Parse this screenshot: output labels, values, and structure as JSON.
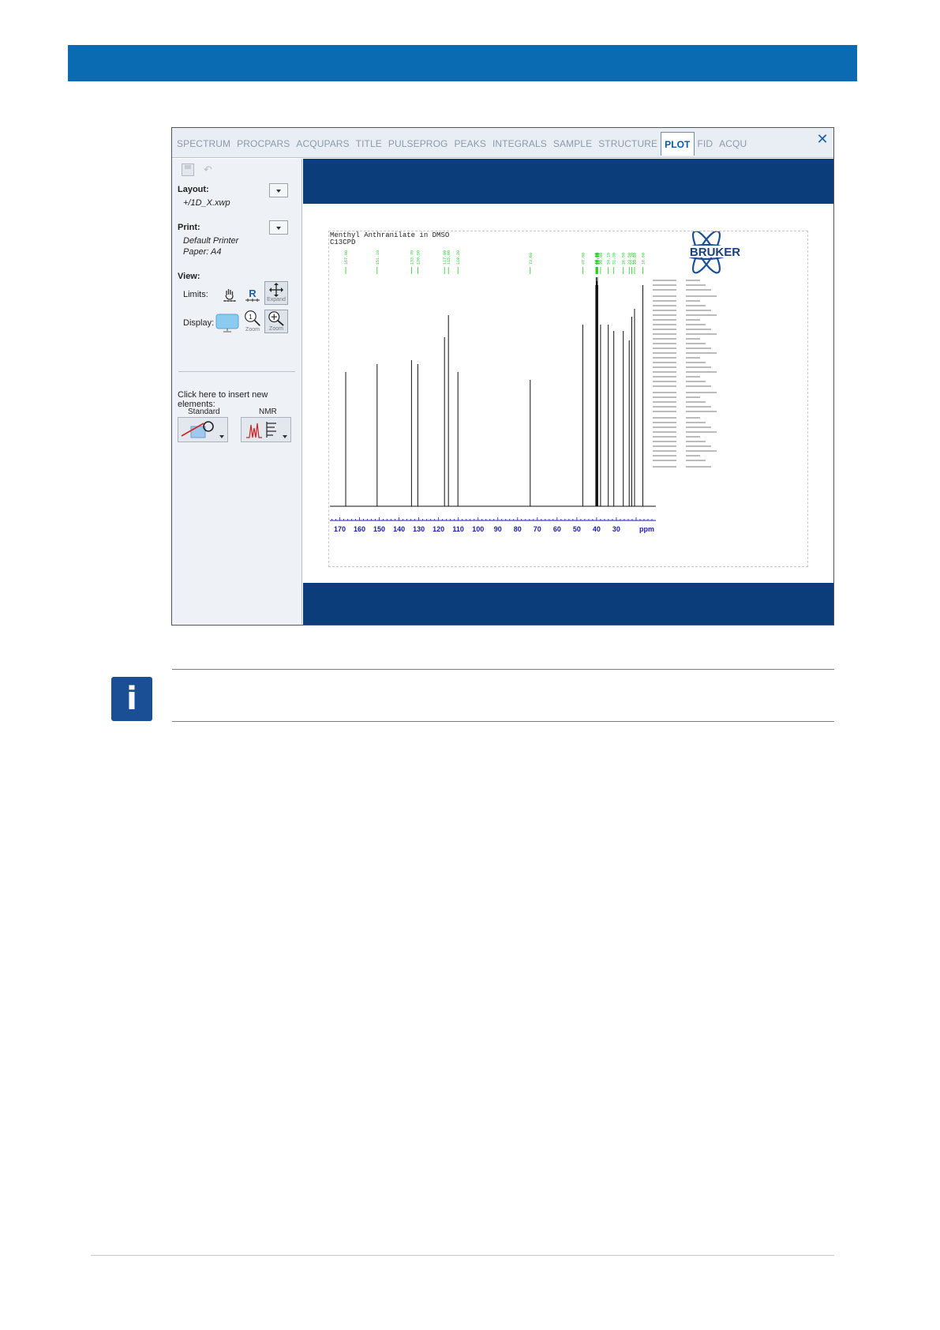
{
  "tabs": [
    "SPECTRUM",
    "PROCPARS",
    "ACQUPARS",
    "TITLE",
    "PULSEPROG",
    "PEAKS",
    "INTEGRALS",
    "SAMPLE",
    "STRUCTURE",
    "PLOT",
    "FID",
    "ACQU"
  ],
  "active_tab": "PLOT",
  "close_symbol": "✕",
  "panel": {
    "layout_label": "Layout:",
    "layout_value": "+/1D_X.xwp",
    "print_label": "Print:",
    "printer_value": "Default Printer",
    "paper_value": "Paper: A4",
    "view_label": "View:",
    "limits_label": "Limits:",
    "limits_r": "R",
    "expand_label": "Expand",
    "display_label": "Display:",
    "zoom_label_1": "Zoom",
    "zoom_label_2": "Zoom",
    "zoom_one": "1",
    "insert_label": "Click here to insert new elements:",
    "standard_label": "Standard",
    "nmr_label": "NMR"
  },
  "plot": {
    "title": "Menthyl Anthranilate in DMSO",
    "subtitle": "C13CPD",
    "logo_text": "BRUKER",
    "x_axis_unit": "ppm",
    "x_ticks": [
      "170",
      "160",
      "150",
      "140",
      "130",
      "120",
      "110",
      "100",
      "90",
      "80",
      "70",
      "60",
      "50",
      "40",
      "30"
    ],
    "peaks_ppm": [
      167.0,
      151.1,
      133.7,
      130.5,
      117.0,
      115.0,
      110.2,
      73.6,
      47.0,
      40.4,
      40.2,
      40.0,
      39.8,
      39.6,
      39.4,
      38.0,
      34.1,
      31.3,
      26.5,
      23.5,
      22.2,
      20.8,
      16.6
    ],
    "colors": {
      "axis": "#1a1ab0",
      "peak_labels": "#22cc22",
      "spectrum": "#111111"
    }
  },
  "colors": {
    "brand_blue": "#0a6bb3",
    "canvas_band": "#0a3d7a",
    "info_icon": "#1a4f96"
  },
  "info_symbol": "i"
}
